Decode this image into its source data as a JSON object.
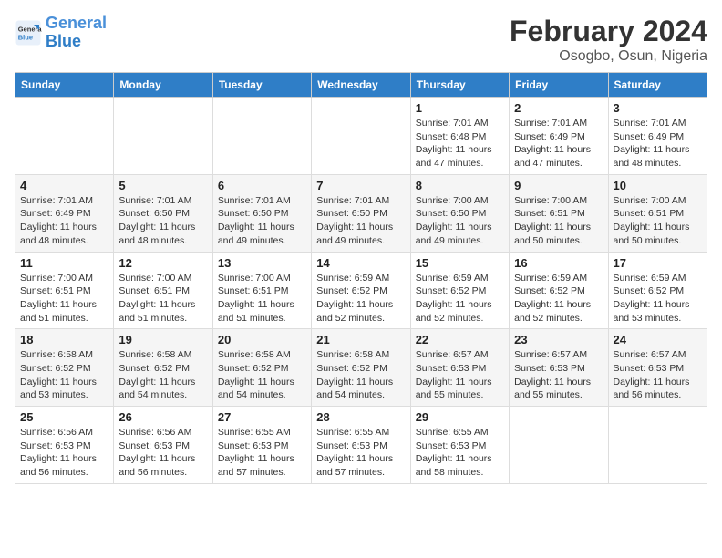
{
  "logo": {
    "line1": "General",
    "line2": "Blue"
  },
  "title": "February 2024",
  "subtitle": "Osogbo, Osun, Nigeria",
  "days_of_week": [
    "Sunday",
    "Monday",
    "Tuesday",
    "Wednesday",
    "Thursday",
    "Friday",
    "Saturday"
  ],
  "weeks": [
    [
      {
        "num": "",
        "info": ""
      },
      {
        "num": "",
        "info": ""
      },
      {
        "num": "",
        "info": ""
      },
      {
        "num": "",
        "info": ""
      },
      {
        "num": "1",
        "info": "Sunrise: 7:01 AM\nSunset: 6:48 PM\nDaylight: 11 hours and 47 minutes."
      },
      {
        "num": "2",
        "info": "Sunrise: 7:01 AM\nSunset: 6:49 PM\nDaylight: 11 hours and 47 minutes."
      },
      {
        "num": "3",
        "info": "Sunrise: 7:01 AM\nSunset: 6:49 PM\nDaylight: 11 hours and 48 minutes."
      }
    ],
    [
      {
        "num": "4",
        "info": "Sunrise: 7:01 AM\nSunset: 6:49 PM\nDaylight: 11 hours and 48 minutes."
      },
      {
        "num": "5",
        "info": "Sunrise: 7:01 AM\nSunset: 6:50 PM\nDaylight: 11 hours and 48 minutes."
      },
      {
        "num": "6",
        "info": "Sunrise: 7:01 AM\nSunset: 6:50 PM\nDaylight: 11 hours and 49 minutes."
      },
      {
        "num": "7",
        "info": "Sunrise: 7:01 AM\nSunset: 6:50 PM\nDaylight: 11 hours and 49 minutes."
      },
      {
        "num": "8",
        "info": "Sunrise: 7:00 AM\nSunset: 6:50 PM\nDaylight: 11 hours and 49 minutes."
      },
      {
        "num": "9",
        "info": "Sunrise: 7:00 AM\nSunset: 6:51 PM\nDaylight: 11 hours and 50 minutes."
      },
      {
        "num": "10",
        "info": "Sunrise: 7:00 AM\nSunset: 6:51 PM\nDaylight: 11 hours and 50 minutes."
      }
    ],
    [
      {
        "num": "11",
        "info": "Sunrise: 7:00 AM\nSunset: 6:51 PM\nDaylight: 11 hours and 51 minutes."
      },
      {
        "num": "12",
        "info": "Sunrise: 7:00 AM\nSunset: 6:51 PM\nDaylight: 11 hours and 51 minutes."
      },
      {
        "num": "13",
        "info": "Sunrise: 7:00 AM\nSunset: 6:51 PM\nDaylight: 11 hours and 51 minutes."
      },
      {
        "num": "14",
        "info": "Sunrise: 6:59 AM\nSunset: 6:52 PM\nDaylight: 11 hours and 52 minutes."
      },
      {
        "num": "15",
        "info": "Sunrise: 6:59 AM\nSunset: 6:52 PM\nDaylight: 11 hours and 52 minutes."
      },
      {
        "num": "16",
        "info": "Sunrise: 6:59 AM\nSunset: 6:52 PM\nDaylight: 11 hours and 52 minutes."
      },
      {
        "num": "17",
        "info": "Sunrise: 6:59 AM\nSunset: 6:52 PM\nDaylight: 11 hours and 53 minutes."
      }
    ],
    [
      {
        "num": "18",
        "info": "Sunrise: 6:58 AM\nSunset: 6:52 PM\nDaylight: 11 hours and 53 minutes."
      },
      {
        "num": "19",
        "info": "Sunrise: 6:58 AM\nSunset: 6:52 PM\nDaylight: 11 hours and 54 minutes."
      },
      {
        "num": "20",
        "info": "Sunrise: 6:58 AM\nSunset: 6:52 PM\nDaylight: 11 hours and 54 minutes."
      },
      {
        "num": "21",
        "info": "Sunrise: 6:58 AM\nSunset: 6:52 PM\nDaylight: 11 hours and 54 minutes."
      },
      {
        "num": "22",
        "info": "Sunrise: 6:57 AM\nSunset: 6:53 PM\nDaylight: 11 hours and 55 minutes."
      },
      {
        "num": "23",
        "info": "Sunrise: 6:57 AM\nSunset: 6:53 PM\nDaylight: 11 hours and 55 minutes."
      },
      {
        "num": "24",
        "info": "Sunrise: 6:57 AM\nSunset: 6:53 PM\nDaylight: 11 hours and 56 minutes."
      }
    ],
    [
      {
        "num": "25",
        "info": "Sunrise: 6:56 AM\nSunset: 6:53 PM\nDaylight: 11 hours and 56 minutes."
      },
      {
        "num": "26",
        "info": "Sunrise: 6:56 AM\nSunset: 6:53 PM\nDaylight: 11 hours and 56 minutes."
      },
      {
        "num": "27",
        "info": "Sunrise: 6:55 AM\nSunset: 6:53 PM\nDaylight: 11 hours and 57 minutes."
      },
      {
        "num": "28",
        "info": "Sunrise: 6:55 AM\nSunset: 6:53 PM\nDaylight: 11 hours and 57 minutes."
      },
      {
        "num": "29",
        "info": "Sunrise: 6:55 AM\nSunset: 6:53 PM\nDaylight: 11 hours and 58 minutes."
      },
      {
        "num": "",
        "info": ""
      },
      {
        "num": "",
        "info": ""
      }
    ]
  ]
}
